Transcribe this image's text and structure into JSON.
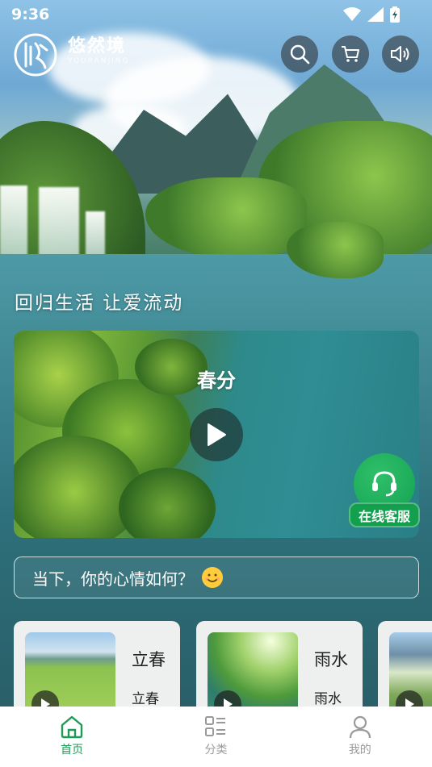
{
  "status_bar": {
    "time": "9:36"
  },
  "header": {
    "brand_cn": "悠然境",
    "brand_en": "YOURANJING",
    "buttons": [
      {
        "icon": "search-icon"
      },
      {
        "icon": "cart-icon"
      },
      {
        "icon": "speaker-icon"
      }
    ]
  },
  "slogan": "回归生活  让爱流动",
  "featured_video": {
    "title": "春分",
    "icon": "play-icon"
  },
  "support": {
    "label": "在线客服",
    "icon": "headset-icon"
  },
  "mood": {
    "prompt": "当下，你的心情如何？",
    "emoji": "smiling-face-emoji"
  },
  "cards": [
    {
      "title": "立春",
      "subtitle": "立春"
    },
    {
      "title": "雨水",
      "subtitle": "雨水"
    },
    {
      "title": "",
      "subtitle": ""
    }
  ],
  "bottom_nav": {
    "items": [
      {
        "label": "首页",
        "icon": "home-icon",
        "active": true
      },
      {
        "label": "分类",
        "icon": "category-icon",
        "active": false
      },
      {
        "label": "我的",
        "icon": "profile-icon",
        "active": false
      }
    ],
    "active_color": "#1f9a57",
    "inactive_color": "#9a9a9a"
  }
}
